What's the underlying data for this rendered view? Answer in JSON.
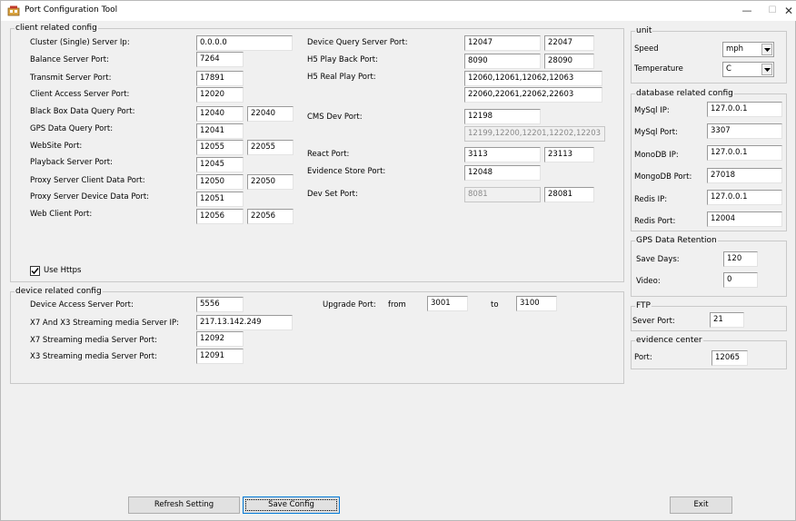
{
  "window": {
    "title": "Port Configuration Tool",
    "minimize": "—",
    "maximize": "☐",
    "close": "✕"
  },
  "client": {
    "legend": "client related config",
    "cluster_ip": {
      "label": "Cluster (Single) Server Ip:",
      "value": "0.0.0.0"
    },
    "balance": {
      "label": "Balance Server Port:",
      "value": "7264"
    },
    "transmit": {
      "label": "Transmit Server Port:",
      "value": "17891"
    },
    "client_access": {
      "label": "Client Access Server Port:",
      "value": "12020"
    },
    "blackbox": {
      "label": "Black Box Data Query Port:",
      "value1": "12040",
      "value2": "22040"
    },
    "gps_query": {
      "label": "GPS Data Query Port:",
      "value": "12041"
    },
    "website": {
      "label": "WebSite Port:",
      "value1": "12055",
      "value2": "22055"
    },
    "playback": {
      "label": "Playback Server Port:",
      "value": "12045"
    },
    "proxy_client": {
      "label": "Proxy Server Client Data Port:",
      "value1": "12050",
      "value2": "22050"
    },
    "proxy_device": {
      "label": "Proxy Server Device Data Port:",
      "value": "12051"
    },
    "web_client": {
      "label": "Web Client Port:",
      "value1": "12056",
      "value2": "22056"
    },
    "device_query": {
      "label": "Device Query Server Port:",
      "value1": "12047",
      "value2": "22047"
    },
    "h5_playback": {
      "label": "H5 Play Back Port:",
      "value1": "8090",
      "value2": "28090"
    },
    "h5_real": {
      "label": "H5 Real Play Port:",
      "value1": "12060,12061,12062,12063",
      "value2": "22060,22061,22062,22603"
    },
    "cms_dev": {
      "label": "CMS Dev Port:",
      "value1": "12198",
      "value2": "12199,12200,12201,12202,12203"
    },
    "react": {
      "label": "React Port:",
      "value1": "3113",
      "value2": "23113"
    },
    "evidence_store": {
      "label": "Evidence Store Port:",
      "value": "12048"
    },
    "dev_set": {
      "label": "Dev Set Port:",
      "value1": "8081",
      "value2": "28081"
    },
    "use_https": {
      "label": "Use Https",
      "checked": true
    }
  },
  "device": {
    "legend": "device related config",
    "access": {
      "label": "Device Access Server Port:",
      "value": "5556"
    },
    "x7x3_ip": {
      "label": "X7 And X3 Streaming media Server IP:",
      "value": "217.13.142.249"
    },
    "x7_port": {
      "label": "X7 Streaming media Server Port:",
      "value": "12092"
    },
    "x3_port": {
      "label": "X3 Streaming media Server Port:",
      "value": "12091"
    },
    "upgrade": {
      "label": "Upgrade Port:",
      "from_label": "from",
      "from": "3001",
      "to_label": "to",
      "to": "3100"
    }
  },
  "unit": {
    "legend": "unit",
    "speed": {
      "label": "Speed",
      "value": "mph"
    },
    "temperature": {
      "label": "Temperature",
      "value": "C"
    }
  },
  "database": {
    "legend": "database related config",
    "mysql_ip": {
      "label": "MySql IP:",
      "value": "127.0.0.1"
    },
    "mysql_port": {
      "label": "MySql Port:",
      "value": "3307"
    },
    "mongo_ip": {
      "label": "MonoDB IP:",
      "value": "127.0.0.1"
    },
    "mongo_port": {
      "label": "MongoDB Port:",
      "value": "27018"
    },
    "redis_ip": {
      "label": "Redis IP:",
      "value": "127.0.0.1"
    },
    "redis_port": {
      "label": "Redis Port:",
      "value": "12004"
    }
  },
  "gps_retention": {
    "legend": "GPS Data Retention",
    "save_days": {
      "label": "Save Days:",
      "value": "120"
    },
    "video": {
      "label": "Video:",
      "value": "0"
    }
  },
  "ftp": {
    "legend": "FTP",
    "port": {
      "label": "Sever Port:",
      "value": "21"
    }
  },
  "evidence": {
    "legend": "evidence center",
    "port": {
      "label": "Port:",
      "value": "12065"
    }
  },
  "buttons": {
    "refresh": "Refresh Setting",
    "save": "Save Config",
    "exit": "Exit"
  }
}
